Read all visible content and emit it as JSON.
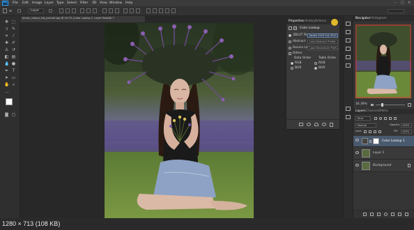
{
  "app": {
    "logo": "Ps",
    "menus": [
      "File",
      "Edit",
      "Image",
      "Layer",
      "Type",
      "Select",
      "Filter",
      "3D",
      "View",
      "Window",
      "Help"
    ]
  },
  "options_bar": {
    "layer_dropdown": "Layer"
  },
  "document": {
    "tab_title": "lovely_unique_hat_portrait.jpg @ 16.7% (Color Lookup 1, Layer Mask/8) *"
  },
  "properties_panel": {
    "tabs": [
      "Properties",
      "History",
      "Actions"
    ],
    "header": "Color Lookup",
    "rows": [
      {
        "label": "3DLUT File",
        "value": "Kodak 5205 Fuji 3510"
      },
      {
        "label": "Abstract",
        "value": "Load Abstract Profile..."
      },
      {
        "label": "Device Link",
        "value": "Load DeviceLink Profi..."
      }
    ],
    "dither_label": "Dither",
    "data_order_label": "Data Order",
    "table_order_label": "Table Order",
    "rgb1": "RGB",
    "bgr1": "BGR",
    "rgb2": "RGB",
    "bgr2": "BGR"
  },
  "navigator": {
    "tabs": [
      "Navigator",
      "Histogram"
    ],
    "zoom": "16.39%"
  },
  "layers_panel": {
    "tabs": [
      "Layers",
      "Channels",
      "Paths"
    ],
    "kind": "Kind",
    "blend_mode": "Normal",
    "opacity_label": "Opacity:",
    "opacity_value": "100%",
    "lock_label": "Lock:",
    "fill_label": "Fill:",
    "fill_value": "100%",
    "layers": [
      {
        "name": "Color Lookup 1"
      },
      {
        "name": "Layer 1"
      },
      {
        "name": "Background"
      }
    ]
  },
  "status": {
    "image_info": "1280 × 713 (108 KB)"
  },
  "colors": {
    "ps_blue": "#31a8ff",
    "panel_bg": "#353535",
    "selected_row": "#4a5a6e"
  }
}
